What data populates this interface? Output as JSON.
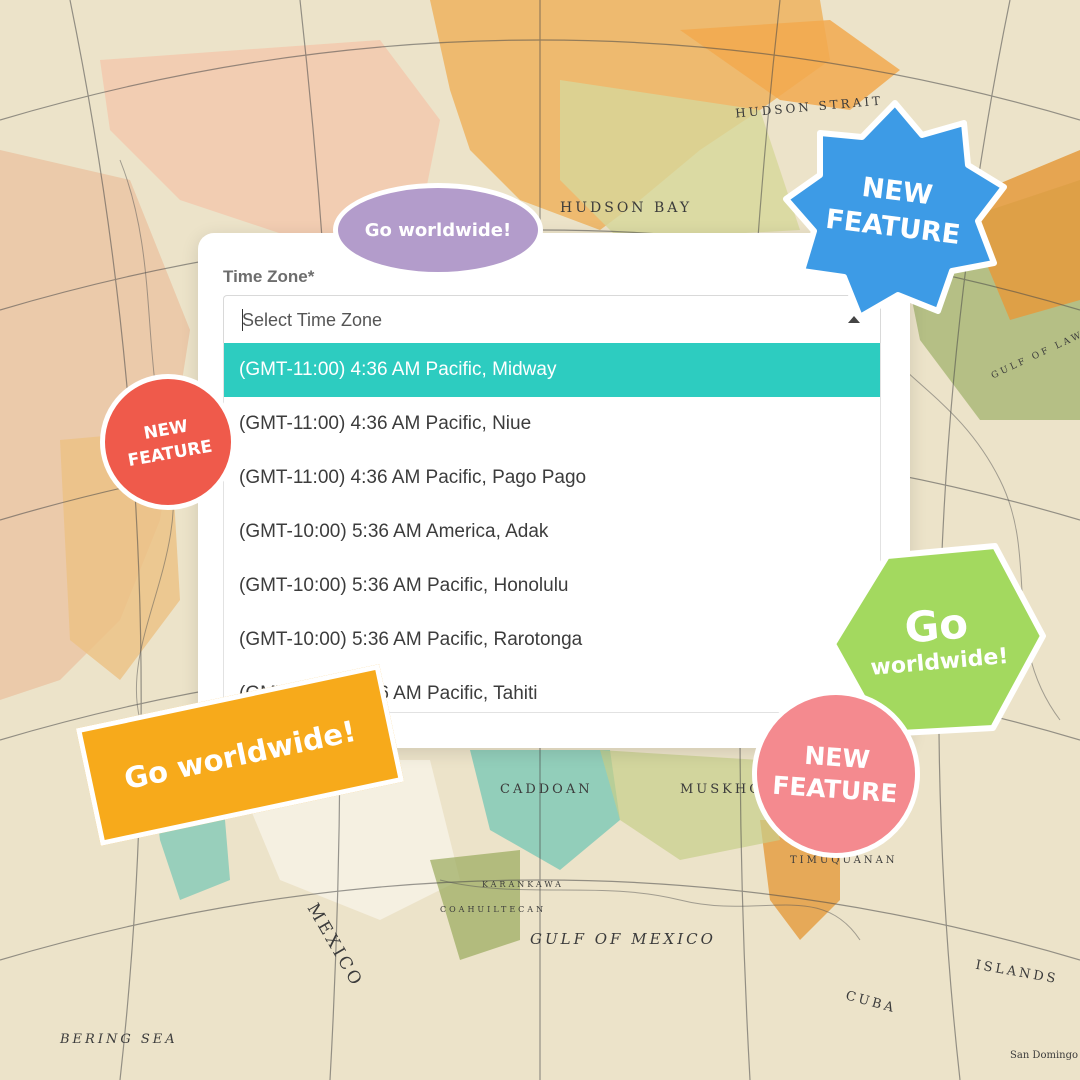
{
  "form": {
    "label": "Time Zone*",
    "placeholder": "Select Time Zone",
    "options": [
      "(GMT-11:00) 4:36 AM Pacific, Midway",
      "(GMT-11:00) 4:36 AM Pacific, Niue",
      "(GMT-11:00) 4:36 AM Pacific, Pago Pago",
      "(GMT-10:00) 5:36 AM America, Adak",
      "(GMT-10:00) 5:36 AM Pacific, Honolulu",
      "(GMT-10:00) 5:36 AM Pacific, Rarotonga",
      "(GMT-10:00) 5:36 AM Pacific, Tahiti"
    ],
    "highlighted_option": "(GMT-11:00) 4:36 AM Pacific, Midway"
  },
  "stickers": {
    "purple_top": "Go worldwide!",
    "blue_top_right": "NEW FEATURE",
    "red_left": "NEW FEATURE",
    "green_hexagon_go": "Go",
    "green_hexagon_worldwide": "worldwide!",
    "orange_banner": "Go worldwide!",
    "pink_circle": "NEW FEATURE"
  },
  "map_labels": {
    "hudson_bay": "HUDSON BAY",
    "hudson_strait": "HUDSON STRAIT",
    "gulf_of_mexico": "GULF OF MEXICO",
    "bering_sea": "BERING SEA",
    "caddoan": "CADDOAN",
    "muskhogean": "MUSKHOG",
    "islands": "ISLANDS",
    "cuba": "CUBA",
    "mexico": "MEXICO",
    "san_domingo": "San Domingo",
    "gulf_of_lawrence": "GULF OF LAWRENCE",
    "karankawan": "KARANKAWA",
    "coahuiltecan": "COAHUILTECAN",
    "timuquanan": "TIMUQUANAN"
  },
  "colors": {
    "highlight": "#2dccc0",
    "purple": "#b39ccb",
    "blue": "#3d9be6",
    "red": "#ef5a4b",
    "green": "#a3d95f",
    "orange": "#f7aa1b",
    "pink": "#f48a8f"
  }
}
